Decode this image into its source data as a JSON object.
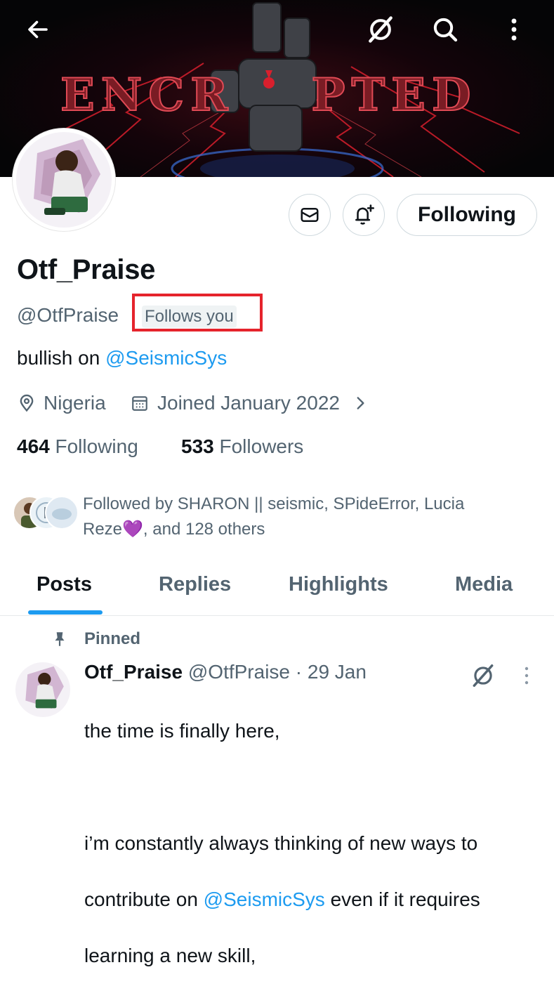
{
  "banner": {
    "text_left": "ENCR",
    "text_right": "PTED"
  },
  "profile": {
    "display_name": "Otf_Praise",
    "handle": "@OtfPraise",
    "follows_you_badge": "Follows you",
    "bio_prefix": "bullish on ",
    "bio_mention": "@SeismicSys",
    "location": "Nigeria",
    "joined": "Joined January 2022",
    "following_count": "464",
    "following_label": "Following",
    "followers_count": "533",
    "followers_label": "Followers",
    "followed_by_line1": "Followed by SHARON || seismic, SPideError, Lucia",
    "followed_by_line2_name": "Reze",
    "followed_by_line2_emoji": "💜",
    "followed_by_line2_rest": ", and 128 others"
  },
  "actions": {
    "following_button": "Following"
  },
  "tabs": [
    {
      "label": "Posts",
      "active": true
    },
    {
      "label": "Replies",
      "active": false
    },
    {
      "label": "Highlights",
      "active": false
    },
    {
      "label": "Media",
      "active": false
    }
  ],
  "post": {
    "pinned_label": "Pinned",
    "author_name": "Otf_Praise",
    "author_handle": "@OtfPraise",
    "date": "· 29 Jan",
    "line1": "the time is finally here,",
    "line2": "i’m constantly always thinking of new ways to",
    "line3_prefix": "contribute on ",
    "line3_mention": "@SeismicSys",
    "line3_suffix": " even if it requires",
    "line4": "learning a new skill,"
  },
  "icons": {
    "back": "arrow-left-icon",
    "grok": "grok-slash-icon",
    "search": "search-icon",
    "more": "more-vertical-icon",
    "message": "envelope-icon",
    "notify": "bell-plus-icon",
    "location": "location-pin-icon",
    "calendar": "calendar-icon",
    "chevron": "chevron-right-icon",
    "pin": "pin-icon"
  },
  "colors": {
    "accent": "#1d9bf0",
    "highlight": "#e5232c",
    "muted": "#536471"
  }
}
